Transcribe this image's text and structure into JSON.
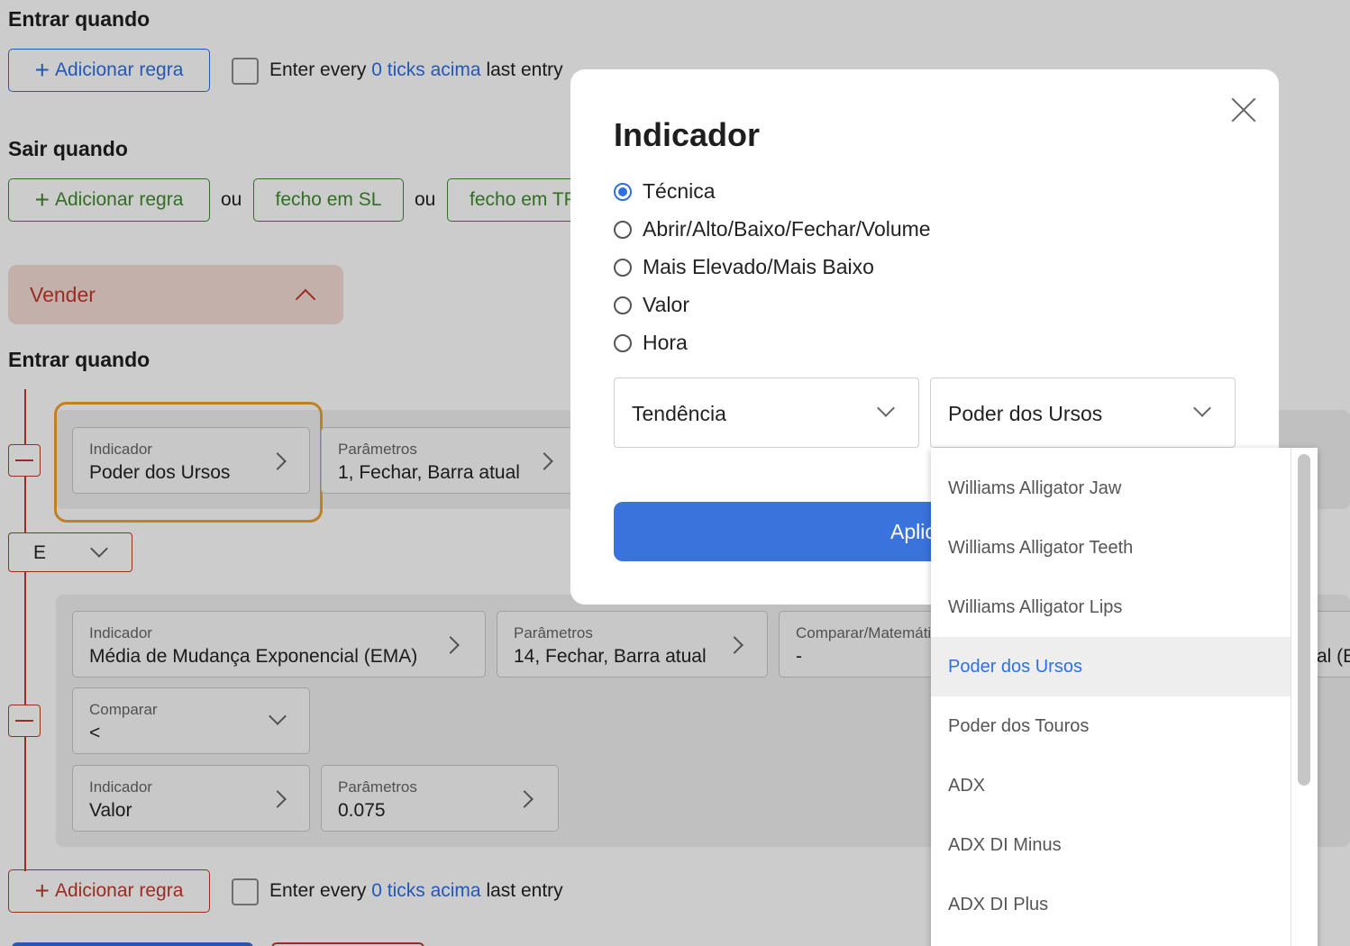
{
  "background": {
    "buy_section": {
      "enter_when_title": "Entrar quando",
      "add_rule_label": "Adicionar regra",
      "enter_every_prefix": "Enter every",
      "enter_every_link": "0 ticks acima",
      "enter_every_suffix": "last entry"
    },
    "exit_section": {
      "title": "Sair quando",
      "add_rule_label": "Adicionar regra",
      "or_1": "ou",
      "close_sl_label": "fecho em SL",
      "or_2": "ou",
      "close_tp_label": "fecho em TP"
    },
    "sell_panel": {
      "title": "Vender"
    },
    "sell_section": {
      "enter_when_title": "Entrar quando",
      "rule1": {
        "indicator_label": "Indicador",
        "indicator_value": "Poder dos Ursos",
        "params_label": "Parâmetros",
        "params_value": "1, Fechar, Barra atual"
      },
      "logic_select": "E",
      "rule2": {
        "indicator_label": "Indicador",
        "indicator_value": "Média de Mudança Exponencial (EMA)",
        "params_label": "Parâmetros",
        "params_value": "14, Fechar, Barra atual",
        "compare_math_label": "Comparar/Matemática",
        "compare_math_value": "-",
        "right_cut_text": "al (E",
        "compare_label": "Comparar",
        "compare_value": "<",
        "indicator2_label": "Indicador",
        "indicator2_value": "Valor",
        "params2_label": "Parâmetros",
        "params2_value": "0.075"
      },
      "add_rule_label": "Adicionar regra",
      "enter_every_prefix": "Enter every",
      "enter_every_link": "0 ticks acima",
      "enter_every_suffix": "last entry"
    }
  },
  "modal": {
    "title": "Indicador",
    "radio_options": [
      {
        "label": "Técnica",
        "checked": true
      },
      {
        "label": "Abrir/Alto/Baixo/Fechar/Volume",
        "checked": false
      },
      {
        "label": "Mais Elevado/Mais Baixo",
        "checked": false
      },
      {
        "label": "Valor",
        "checked": false
      },
      {
        "label": "Hora",
        "checked": false
      }
    ],
    "category_select": "Tendência",
    "indicator_select": "Poder dos Ursos",
    "apply_label": "Aplicar"
  },
  "dropdown": {
    "items": [
      "Williams Alligator Jaw",
      "Williams Alligator Teeth",
      "Williams Alligator Lips",
      "Poder dos Ursos",
      "Poder dos Touros",
      "ADX",
      "ADX DI Minus",
      "ADX DI Plus"
    ],
    "selected": "Poder dos Ursos"
  },
  "colors": {
    "accent_blue": "#2f6fe0",
    "buy_blue": "#2f6fe0",
    "exit_green": "#3f8a2e",
    "sell_red": "#c0392b",
    "highlight_orange": "#f0a030",
    "sell_panel_bg": "#f6dcd6"
  }
}
